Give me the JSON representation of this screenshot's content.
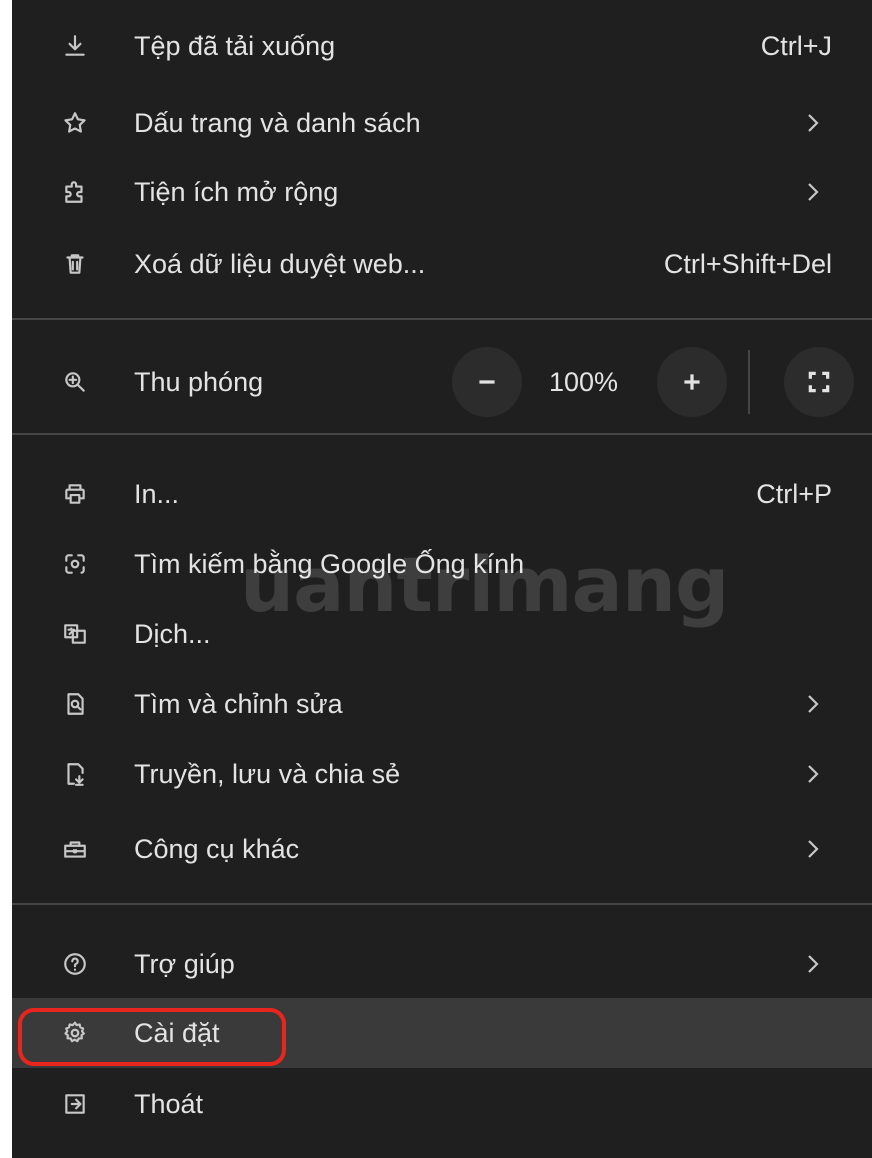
{
  "menu": {
    "downloads": {
      "label": "Tệp đã tải xuống",
      "shortcut": "Ctrl+J",
      "icon": "download-icon"
    },
    "bookmarks": {
      "label": "Dấu trang và danh sách",
      "icon": "star-icon"
    },
    "extensions": {
      "label": "Tiện ích mở rộng",
      "icon": "puzzle-icon"
    },
    "clear_data": {
      "label": "Xoá dữ liệu duyệt web...",
      "shortcut": "Ctrl+Shift+Del",
      "icon": "trash-icon"
    },
    "zoom": {
      "label": "Thu phóng",
      "value": "100%",
      "icon": "zoom-icon"
    },
    "print": {
      "label": "In...",
      "shortcut": "Ctrl+P",
      "icon": "printer-icon"
    },
    "google_lens": {
      "label": "Tìm kiếm bằng Google Ống kính",
      "icon": "lens-icon"
    },
    "translate": {
      "label": "Dịch...",
      "icon": "translate-icon"
    },
    "find_edit": {
      "label": "Tìm và chỉnh sửa",
      "icon": "find-page-icon"
    },
    "cast_save_share": {
      "label": "Truyền, lưu và chia sẻ",
      "icon": "cast-save-icon"
    },
    "more_tools": {
      "label": "Công cụ khác",
      "icon": "toolbox-icon"
    },
    "help": {
      "label": "Trợ giúp",
      "icon": "help-icon"
    },
    "settings": {
      "label": "Cài đặt",
      "icon": "gear-icon"
    },
    "exit": {
      "label": "Thoát",
      "icon": "exit-icon"
    }
  },
  "watermark": {
    "text": "uantrimang"
  },
  "colors": {
    "background": "#1f1f1f",
    "highlight": "#3a3a3a",
    "text": "#e3e3e3",
    "annotation": "#e8261d"
  }
}
